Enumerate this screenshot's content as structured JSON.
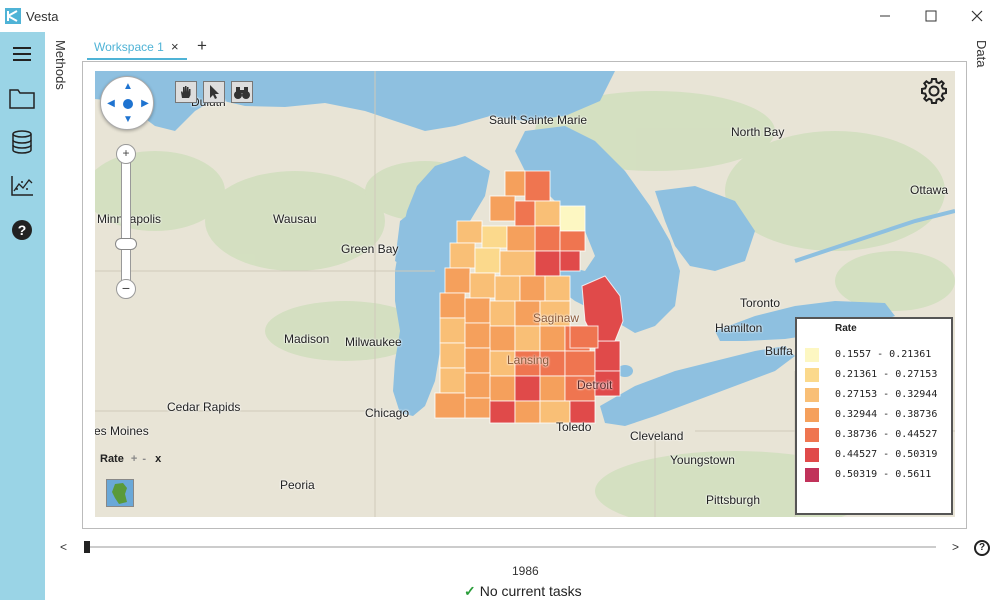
{
  "window": {
    "title": "Vesta",
    "minimize_icon": "minimize-icon",
    "maximize_icon": "maximize-icon",
    "close_icon": "close-icon"
  },
  "rail": {
    "items": [
      "menu-icon",
      "folder-icon",
      "database-icon",
      "chart-icon",
      "help-icon"
    ]
  },
  "side_labels": {
    "left": "Methods",
    "right": "Data"
  },
  "tabs": [
    {
      "label": "Workspace 1",
      "close": "×"
    }
  ],
  "tab_add": "+",
  "map": {
    "cities": {
      "duluth": "Duluth",
      "sault": "Sault Sainte Marie",
      "northbay": "North Bay",
      "ottawa": "Ottawa",
      "minneapolis": "Minneapolis",
      "wausau": "Wausau",
      "greenbay": "Green Bay",
      "toronto": "Toronto",
      "hamilton": "Hamilton",
      "buffalo": "Buffa",
      "madison": "Madison",
      "milwaukee": "Milwaukee",
      "saginaw": "Saginaw",
      "lansing": "Lansing",
      "detroit": "Detroit",
      "chicago": "Chicago",
      "cedarrapids": "Cedar Rapids",
      "desmoines": "es Moines",
      "toledo": "Toledo",
      "cleveland": "Cleveland",
      "youngstown": "Youngstown",
      "peoria": "Peoria",
      "pittsburgh": "Pittsburgh"
    },
    "layer_label": "Rate",
    "layer_controls": {
      "add": "+",
      "remove": "-",
      "close": "x"
    },
    "zoom_plus": "+",
    "zoom_minus": "−"
  },
  "legend": {
    "title": "Rate",
    "items": [
      {
        "label": "0.1557 - 0.21361",
        "color": "#fdf7c2"
      },
      {
        "label": "0.21361 - 0.27153",
        "color": "#fbd98c"
      },
      {
        "label": "0.27153 - 0.32944",
        "color": "#f9bf76"
      },
      {
        "label": "0.32944 - 0.38736",
        "color": "#f5a05c"
      },
      {
        "label": "0.38736 - 0.44527",
        "color": "#ef7550"
      },
      {
        "label": "0.44527 - 0.50319",
        "color": "#e04a4a"
      },
      {
        "label": "0.50319 - 0.5611",
        "color": "#c1325a"
      }
    ]
  },
  "timeline": {
    "prev": "<",
    "next": ">",
    "help": "?",
    "year": "1986"
  },
  "status": {
    "text": "No current tasks"
  }
}
